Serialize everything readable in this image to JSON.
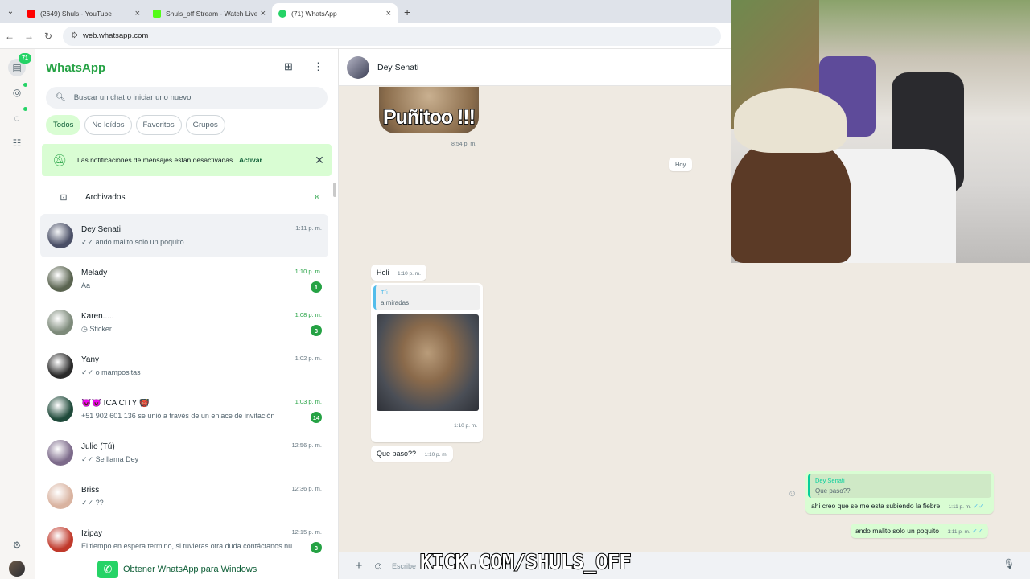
{
  "browser": {
    "tabs": [
      {
        "title": "(2649) Shuls - YouTube",
        "favicon_color": "#ff0000"
      },
      {
        "title": "Shuls_off Stream - Watch Live o",
        "favicon_color": "#53fc18"
      },
      {
        "title": "(71) WhatsApp",
        "favicon_color": "#25d366"
      }
    ],
    "url": "web.whatsapp.com"
  },
  "rail": {
    "badge": "71"
  },
  "sidebar": {
    "title": "WhatsApp",
    "search_placeholder": "Buscar un chat o iniciar uno nuevo",
    "chips": [
      "Todos",
      "No leídos",
      "Favoritos",
      "Grupos"
    ],
    "notification": {
      "text": "Las notificaciones de mensajes están desactivadas.",
      "action": "Activar"
    },
    "archived": {
      "label": "Archivados",
      "count": "8"
    },
    "chats": [
      {
        "name": "Dey Senati",
        "preview": "✓✓ ando malito solo un poquito",
        "time": "1:11 p. m.",
        "unread": "",
        "avatar": "#4a4f66"
      },
      {
        "name": "Melady",
        "preview": "Aa",
        "time": "1:10 p. m.",
        "unread": "1",
        "avatar": "#5a6450"
      },
      {
        "name": "Karen.....",
        "preview": "◷ Sticker",
        "time": "1:08 p. m.",
        "unread": "3",
        "avatar": "#7d8a7a"
      },
      {
        "name": "Yany",
        "preview": "✓✓ o mampositas",
        "time": "1:02 p. m.",
        "unread": "",
        "avatar": "#2a2a2a"
      },
      {
        "name": "😈😈 ICA CITY 👹",
        "preview": "+51 902 601 136 se unió a través de un enlace de invitación",
        "time": "1:03 p. m.",
        "unread": "14",
        "avatar": "#1f4a3a"
      },
      {
        "name": "Julio (Tú)",
        "preview": "✓✓ Se llama Dey",
        "time": "12:56 p. m.",
        "unread": "",
        "avatar": "#7c6a8a"
      },
      {
        "name": "Briss",
        "preview": "✓✓ ??",
        "time": "12:36 p. m.",
        "unread": "",
        "avatar": "#d9b3a0"
      },
      {
        "name": "Izipay",
        "preview": "El tiempo en espera termino, si tuvieras otra duda contáctanos nu...",
        "time": "12:15 p. m.",
        "unread": "3",
        "avatar": "#c0392b"
      }
    ],
    "get_windows": "Obtener WhatsApp para Windows"
  },
  "conversation": {
    "contact": "Dey Senati",
    "sticker_text": "Puñitoo !!!",
    "sticker_time": "8:54 p. m.",
    "day_pill": "Hoy",
    "messages": {
      "holi": {
        "text": "Holi",
        "time": "1:10 p. m."
      },
      "quoted_image": {
        "quote_name": "Tú",
        "quote_text": "a miradas",
        "time": "1:10 p. m."
      },
      "que_paso": {
        "text": "Que paso??",
        "time": "1:10 p. m."
      },
      "reply": {
        "quote_name": "Dey Senati",
        "quote_text": "Que paso??",
        "text": "ahi creo que se me esta subiendo la fiebre",
        "time": "1:11 p. m."
      },
      "last": {
        "text": "ando malito solo un poquito",
        "time": "1:11 p. m."
      }
    },
    "composer_placeholder": "Escribe"
  },
  "overlay": {
    "kick_k": "K",
    "kick_rest": "KICK.COM/SHULS_OFF"
  }
}
